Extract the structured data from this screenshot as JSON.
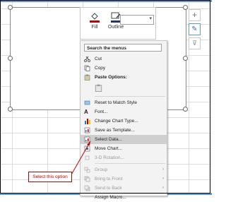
{
  "mini_toolbar": {
    "fill_label": "Fill",
    "outline_label": "Outline",
    "dropdown_arrow": "▾"
  },
  "context_menu": {
    "search_placeholder": "Search the menus",
    "items": [
      {
        "label": "Cut",
        "icon": "scissors-icon",
        "disabled": false
      },
      {
        "label": "Copy",
        "icon": "copy-icon",
        "disabled": false
      },
      {
        "label": "Paste Options:",
        "icon": "paste-icon",
        "disabled": false,
        "bold": true
      },
      {
        "label": "",
        "icon": "paste-option-icon",
        "disabled": false
      },
      {
        "label": "Reset to Match Style",
        "icon": "reset-style-icon",
        "disabled": false
      },
      {
        "label": "Font...",
        "icon": "font-icon",
        "disabled": false
      },
      {
        "label": "Change Chart Type...",
        "icon": "chart-type-icon",
        "disabled": false
      },
      {
        "label": "Save as Template...",
        "icon": "template-icon",
        "disabled": false
      },
      {
        "label": "Select Data...",
        "icon": "select-data-icon",
        "disabled": false,
        "highlighted": true
      },
      {
        "label": "Move Chart...",
        "icon": "move-chart-icon",
        "disabled": false
      },
      {
        "label": "3-D Rotation...",
        "icon": "rotation-icon",
        "disabled": true
      },
      {
        "label": "Group",
        "icon": "group-icon",
        "disabled": true,
        "submenu": true
      },
      {
        "label": "Bring to Front",
        "icon": "bring-front-icon",
        "disabled": true,
        "submenu": true
      },
      {
        "label": "Send to Back",
        "icon": "send-back-icon",
        "disabled": true,
        "submenu": true
      },
      {
        "label": "Assign Macro...",
        "icon": "macro-icon",
        "disabled": false
      }
    ]
  },
  "side_buttons": [
    {
      "icon": "plus-icon",
      "glyph": "+"
    },
    {
      "icon": "brush-icon",
      "glyph": "✎"
    },
    {
      "icon": "filter-icon",
      "glyph": "⊽"
    }
  ],
  "callout": {
    "text": "Select this option",
    "color": "#c00000"
  },
  "colors": {
    "accent_blue": "#5b9bd5",
    "highlight": "#cfcfcf",
    "callout_red": "#c00000"
  }
}
